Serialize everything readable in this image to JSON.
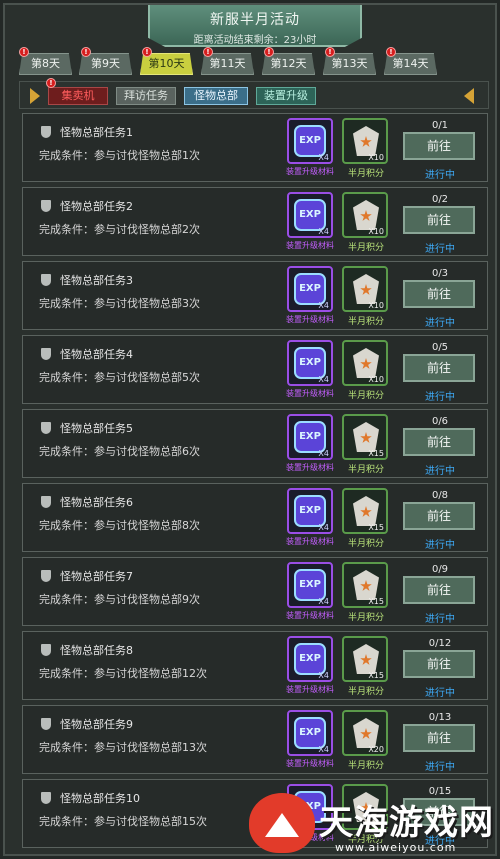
{
  "header": {
    "title": "新服半月活动",
    "subtitle": "距离活动结束剩余：23小时"
  },
  "day_tabs": [
    {
      "label": "第8天",
      "active": false
    },
    {
      "label": "第9天",
      "active": false
    },
    {
      "label": "第10天",
      "active": true
    },
    {
      "label": "第11天",
      "active": false
    },
    {
      "label": "第12天",
      "active": false
    },
    {
      "label": "第13天",
      "active": false
    },
    {
      "label": "第14天",
      "active": false
    }
  ],
  "notification_mark": "!",
  "sub_tabs": [
    {
      "label": "集卖机"
    },
    {
      "label": "拜访任务"
    },
    {
      "label": "怪物总部"
    },
    {
      "label": "装置升级"
    }
  ],
  "reward_labels": {
    "exp_label": "装置升级材料",
    "exp_icon_text": "EXP",
    "half_label": "半月积分"
  },
  "button_label": "前往",
  "status_label": "进行中",
  "tasks": [
    {
      "name": "怪物总部任务1",
      "condition": "完成条件：参与讨伐怪物总部1次",
      "exp_qty": "X4",
      "half_qty": "X10",
      "progress": "0/1"
    },
    {
      "name": "怪物总部任务2",
      "condition": "完成条件：参与讨伐怪物总部2次",
      "exp_qty": "X4",
      "half_qty": "X10",
      "progress": "0/2"
    },
    {
      "name": "怪物总部任务3",
      "condition": "完成条件：参与讨伐怪物总部3次",
      "exp_qty": "X4",
      "half_qty": "X10",
      "progress": "0/3"
    },
    {
      "name": "怪物总部任务4",
      "condition": "完成条件：参与讨伐怪物总部5次",
      "exp_qty": "X4",
      "half_qty": "X10",
      "progress": "0/5"
    },
    {
      "name": "怪物总部任务5",
      "condition": "完成条件：参与讨伐怪物总部6次",
      "exp_qty": "X4",
      "half_qty": "X15",
      "progress": "0/6"
    },
    {
      "name": "怪物总部任务6",
      "condition": "完成条件：参与讨伐怪物总部8次",
      "exp_qty": "X4",
      "half_qty": "X15",
      "progress": "0/8"
    },
    {
      "name": "怪物总部任务7",
      "condition": "完成条件：参与讨伐怪物总部9次",
      "exp_qty": "X4",
      "half_qty": "X15",
      "progress": "0/9"
    },
    {
      "name": "怪物总部任务8",
      "condition": "完成条件：参与讨伐怪物总部12次",
      "exp_qty": "X4",
      "half_qty": "X15",
      "progress": "0/12"
    },
    {
      "name": "怪物总部任务9",
      "condition": "完成条件：参与讨伐怪物总部13次",
      "exp_qty": "X4",
      "half_qty": "X20",
      "progress": "0/13"
    },
    {
      "name": "怪物总部任务10",
      "condition": "完成条件：参与讨伐怪物总部15次",
      "exp_qty": "",
      "half_qty": "",
      "progress": "0/15"
    }
  ],
  "watermark": {
    "text": "天海游戏网",
    "url": "www.aiweiyou.com"
  },
  "colors": {
    "active_tab": "#c9cf3f",
    "status_blue": "#3da9f5",
    "badge_red": "#d61e1e",
    "exp_label_purple": "#c45fff",
    "half_label_green": "#b9e37a"
  }
}
